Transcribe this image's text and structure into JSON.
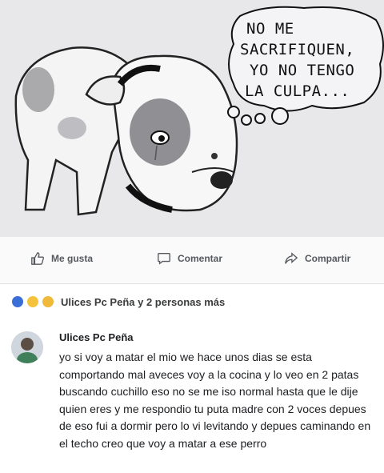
{
  "image": {
    "bubble_lines": [
      "NO ME",
      "SACRIFIQUEN,",
      "YO NO TENGO",
      "LA CULPA..."
    ]
  },
  "actions": {
    "like_label": "Me gusta",
    "comment_label": "Comentar",
    "share_label": "Compartir"
  },
  "reactions": {
    "summary": "Ulices Pc Peña y 2 personas más"
  },
  "comment": {
    "author": "Ulices Pc Peña",
    "text": "yo si voy a matar el mio we hace unos dias se esta comportando mal aveces voy a la cocina y lo veo en 2 patas buscando cuchillo eso no se me iso normal hasta que le dije quien eres y me respondio tu puta madre con 2 voces depues de eso fui a dormir pero lo vi levitando y depues caminando en el techo creo que voy a matar a ese perro"
  },
  "colors": {
    "accent": "#3b6fd8",
    "text": "#1c1e21",
    "muted": "#55595f"
  }
}
